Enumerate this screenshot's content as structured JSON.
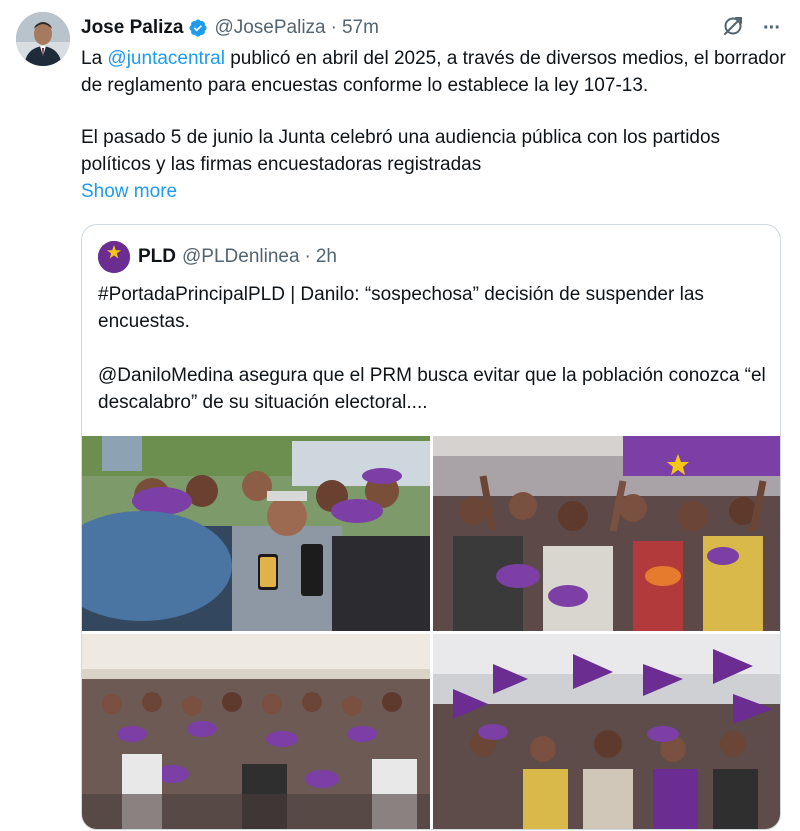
{
  "author": {
    "name": "Jose Paliza",
    "handle": "@JosePaliza",
    "separator": "·",
    "time": "57m",
    "avatar_icon": "profile-photo",
    "verified_color": "#1d9bf0"
  },
  "header_actions": {
    "grok_icon": "grok-icon",
    "more_icon": "more-icon",
    "more_glyph": "···"
  },
  "tweet": {
    "p1_pre": "La ",
    "p1_mention": "@juntacentral",
    "p1_post": " publicó en abril del 2025, a través de diversos medios, el borrador de reglamento para encuestas conforme lo establece la ley 107-13.",
    "p2": "El pasado 5 de junio la Junta celebró una audiencia pública con los partidos políticos y las firmas encuestadoras registradas",
    "show_more": "Show more"
  },
  "quote": {
    "name": "PLD",
    "handle": "@PLDenlinea",
    "separator": "·",
    "time": "2h",
    "avatar_label": "PLD",
    "p1": "#PortadaPrincipalPLD | Danilo: “sospechosa” decisión de suspender las encuestas.",
    "p2": "@DaniloMedina asegura que el PRM busca evitar que la población conozca “el descalabro” de su situación electoral....",
    "photos": [
      "photo-danilo-greeting-supporters",
      "photo-crowd-cheering-event-hall",
      "photo-seated-crowd-purple-caps",
      "photo-crowd-waving-purple-flags"
    ]
  },
  "colors": {
    "text": "#0f1419",
    "secondary": "#536471",
    "link": "#1d9bf0",
    "border": "#cfd9de",
    "pld_purple": "#6b2d91"
  }
}
